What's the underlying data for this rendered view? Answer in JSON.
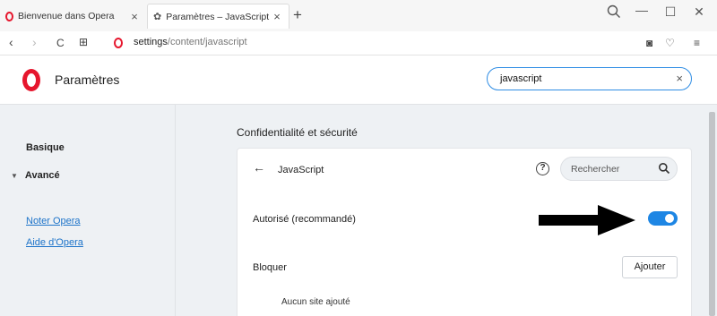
{
  "tabs": [
    {
      "title": "Bienvenue dans Opera",
      "close": "×"
    },
    {
      "title": "Paramètres – JavaScript",
      "close": "×"
    }
  ],
  "window": {
    "new_tab": "+",
    "search": "search-icon",
    "minimize": "—",
    "maximize": "☐",
    "close": "✕"
  },
  "address": {
    "back": "‹",
    "forward": "›",
    "reload": "C",
    "speed_dial": "⊞",
    "url_host": "settings",
    "url_path": "/content/javascript",
    "snapshot": "◙",
    "heart": "♡",
    "menu": "≡"
  },
  "header": {
    "title": "Paramètres",
    "search_value": "javascript",
    "clear": "×"
  },
  "sidebar": {
    "basique": "Basique",
    "avance": "Avancé",
    "noter": "Noter Opera",
    "aide": "Aide d'Opera"
  },
  "main": {
    "section_title": "Confidentialité et sécurité",
    "card": {
      "title": "JavaScript",
      "search_placeholder": "Rechercher",
      "allowed_label": "Autorisé (recommandé)",
      "allowed_on": true,
      "block_label": "Bloquer",
      "add_button": "Ajouter",
      "empty_text": "Aucun site ajouté"
    }
  },
  "colors": {
    "accent": "#1e86e4",
    "brand": "#e6162d",
    "link": "#1c73c9"
  }
}
